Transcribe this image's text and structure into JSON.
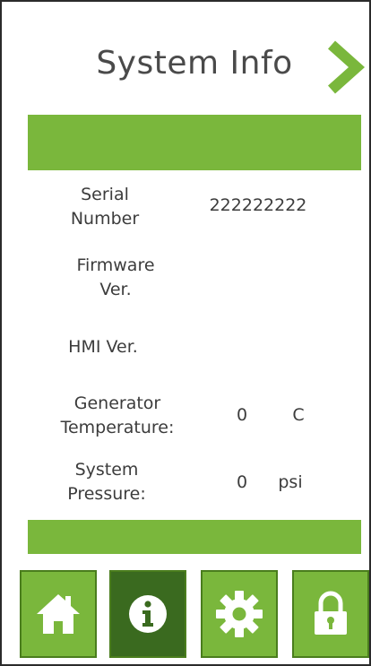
{
  "header": {
    "title": "System Info"
  },
  "info": {
    "serial_label": "Serial Number",
    "serial_value": "222222222",
    "firmware_label": "Firmware Ver.",
    "firmware_value": "",
    "hmi_label": "HMI Ver.",
    "hmi_value": "",
    "gen_temp_label": "Generator Temperature:",
    "gen_temp_value": "0",
    "gen_temp_unit": "C",
    "pressure_label": "System Pressure:",
    "pressure_value": "0",
    "pressure_unit": "psi"
  },
  "nav": {
    "items": [
      "home-icon",
      "info-icon",
      "gear-icon",
      "lock-icon"
    ],
    "active": "info-icon"
  },
  "colors": {
    "accent": "#7ab73c",
    "active": "#3a6a1f"
  }
}
